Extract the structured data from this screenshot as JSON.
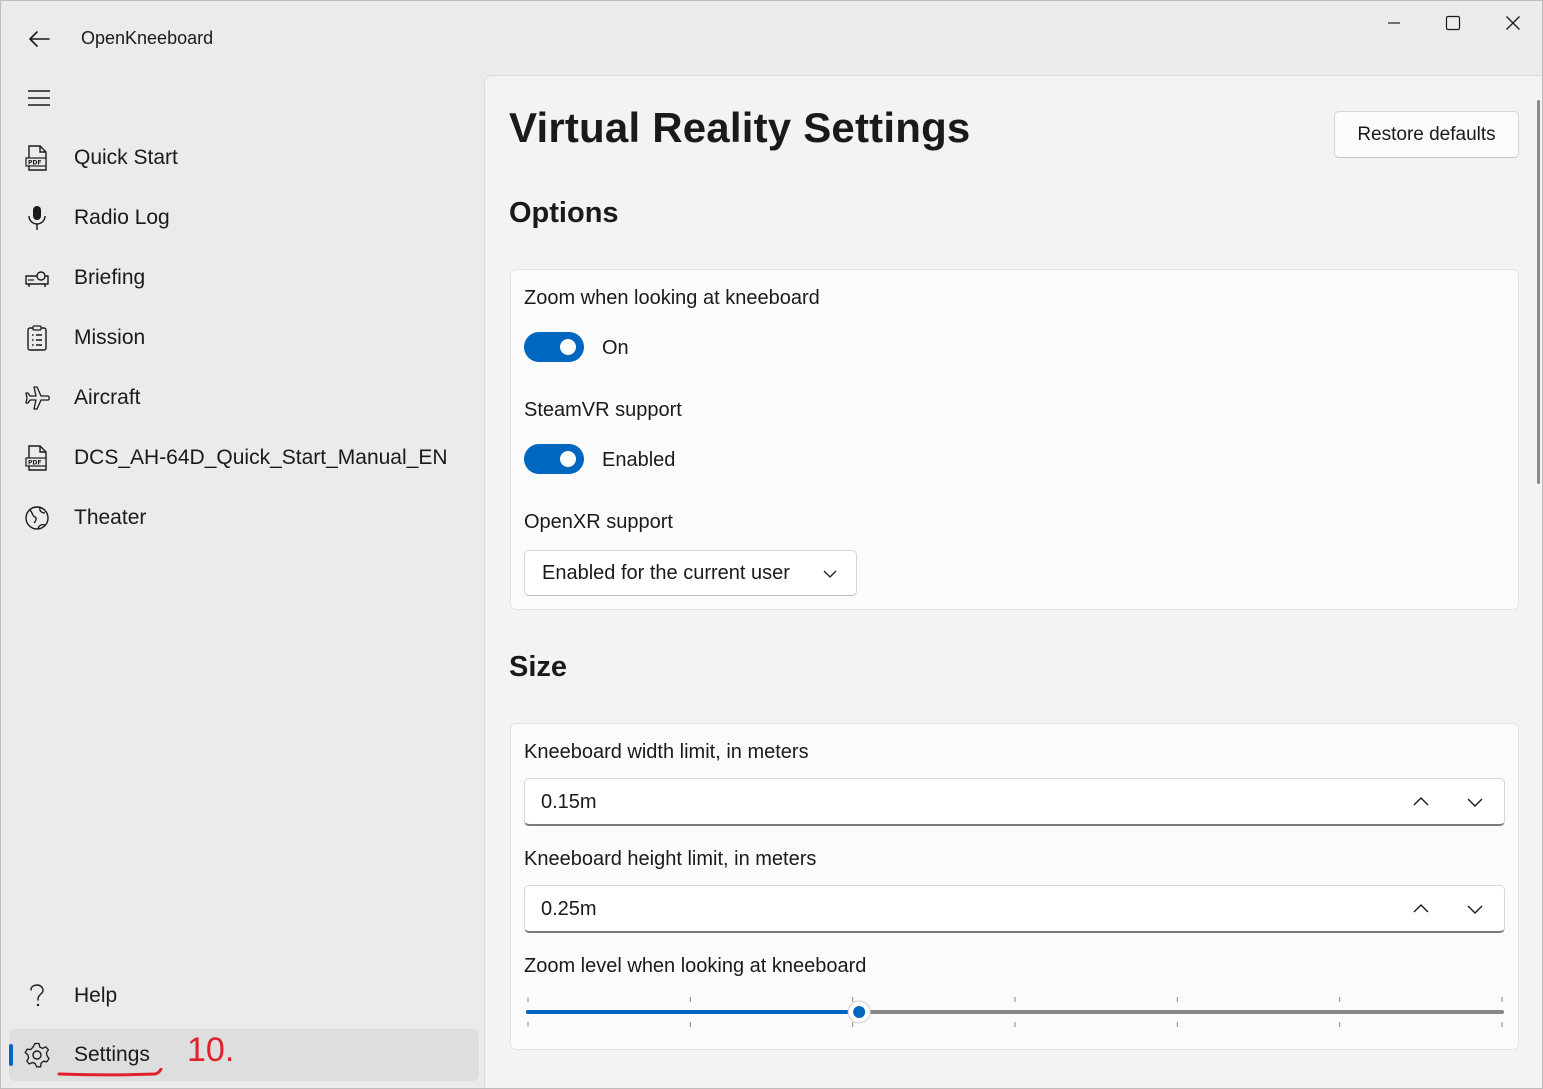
{
  "app": {
    "title": "OpenKneeboard"
  },
  "window_controls": [
    "minimize-icon",
    "maximize-icon",
    "close-icon"
  ],
  "sidebar": {
    "items": [
      {
        "label": "Quick Start",
        "icon": "pdf-document-icon"
      },
      {
        "label": "Radio Log",
        "icon": "microphone-icon"
      },
      {
        "label": "Briefing",
        "icon": "projector-icon"
      },
      {
        "label": "Mission",
        "icon": "clipboard-list-icon"
      },
      {
        "label": "Aircraft",
        "icon": "airplane-icon"
      },
      {
        "label": "DCS_AH-64D_Quick_Start_Manual_EN",
        "icon": "pdf-document-icon"
      },
      {
        "label": "Theater",
        "icon": "globe-icon"
      }
    ],
    "footer": [
      {
        "label": "Help",
        "icon": "question-icon"
      },
      {
        "label": "Settings",
        "icon": "gear-icon",
        "selected": true
      }
    ]
  },
  "annotation": {
    "text": "10.",
    "color": "#e0202a"
  },
  "page": {
    "title": "Virtual Reality Settings",
    "restore_button": "Restore defaults",
    "options": {
      "heading": "Options",
      "zoom_label": "Zoom when looking at kneeboard",
      "zoom_state": "On",
      "zoom_on": true,
      "steamvr_label": "SteamVR support",
      "steamvr_state": "Enabled",
      "steamvr_on": true,
      "openxr_label": "OpenXR support",
      "openxr_value": "Enabled for the current user"
    },
    "size": {
      "heading": "Size",
      "width_label": "Kneeboard width limit, in meters",
      "width_value": "0.15m",
      "height_label": "Kneeboard height limit, in meters",
      "height_value": "0.25m",
      "zoom_level_label": "Zoom level when looking at kneeboard",
      "zoom_level_fraction": 0.34,
      "zoom_level_ticks": 7
    }
  },
  "colors": {
    "accent": "#0067c0",
    "window_bg": "#ebebeb",
    "content_bg": "#f3f3f3",
    "card_bg": "#fbfbfb"
  }
}
